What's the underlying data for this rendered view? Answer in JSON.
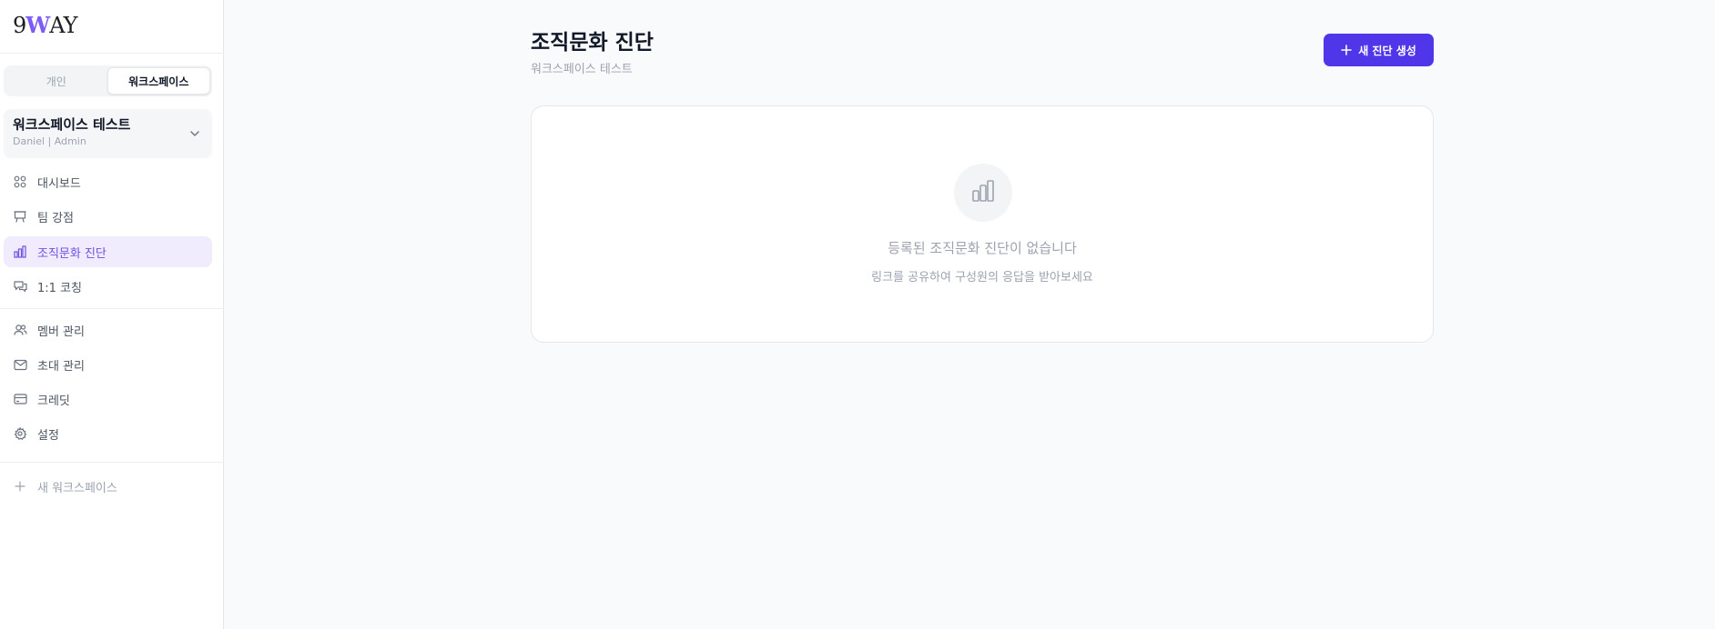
{
  "brand": {
    "logo_text": "9WAY"
  },
  "sidebar": {
    "toggle": {
      "personal": "개인",
      "workspace": "워크스페이스"
    },
    "workspace": {
      "name": "워크스페이스 테스트",
      "sub": "Daniel | Admin"
    },
    "items": [
      {
        "label": "대시보드",
        "icon": "grid-circles-icon"
      },
      {
        "label": "팀 강점",
        "icon": "easel-icon"
      },
      {
        "label": "조직문화 진단",
        "icon": "bar-chart-icon",
        "active": true
      },
      {
        "label": "1:1 코칭",
        "icon": "chat-bubbles-icon"
      },
      {
        "label": "멤버 관리",
        "icon": "users-icon"
      },
      {
        "label": "초대 관리",
        "icon": "mail-icon"
      },
      {
        "label": "크레딧",
        "icon": "credit-card-icon"
      },
      {
        "label": "설정",
        "icon": "gear-icon"
      }
    ],
    "new_workspace": "새 워크스페이스"
  },
  "main": {
    "title": "조직문화 진단",
    "subtitle": "워크스페이스 테스트",
    "create_button": "새 진단 생성",
    "empty": {
      "title": "등록된 조직문화 진단이 없습니다",
      "description": "링크를 공유하여 구성원의 응답을 받아보세요"
    }
  },
  "colors": {
    "accent": "#4f36e8",
    "active_bg": "#f0ecfd",
    "active_text": "#6d4fe0",
    "background": "#f9fafb"
  }
}
